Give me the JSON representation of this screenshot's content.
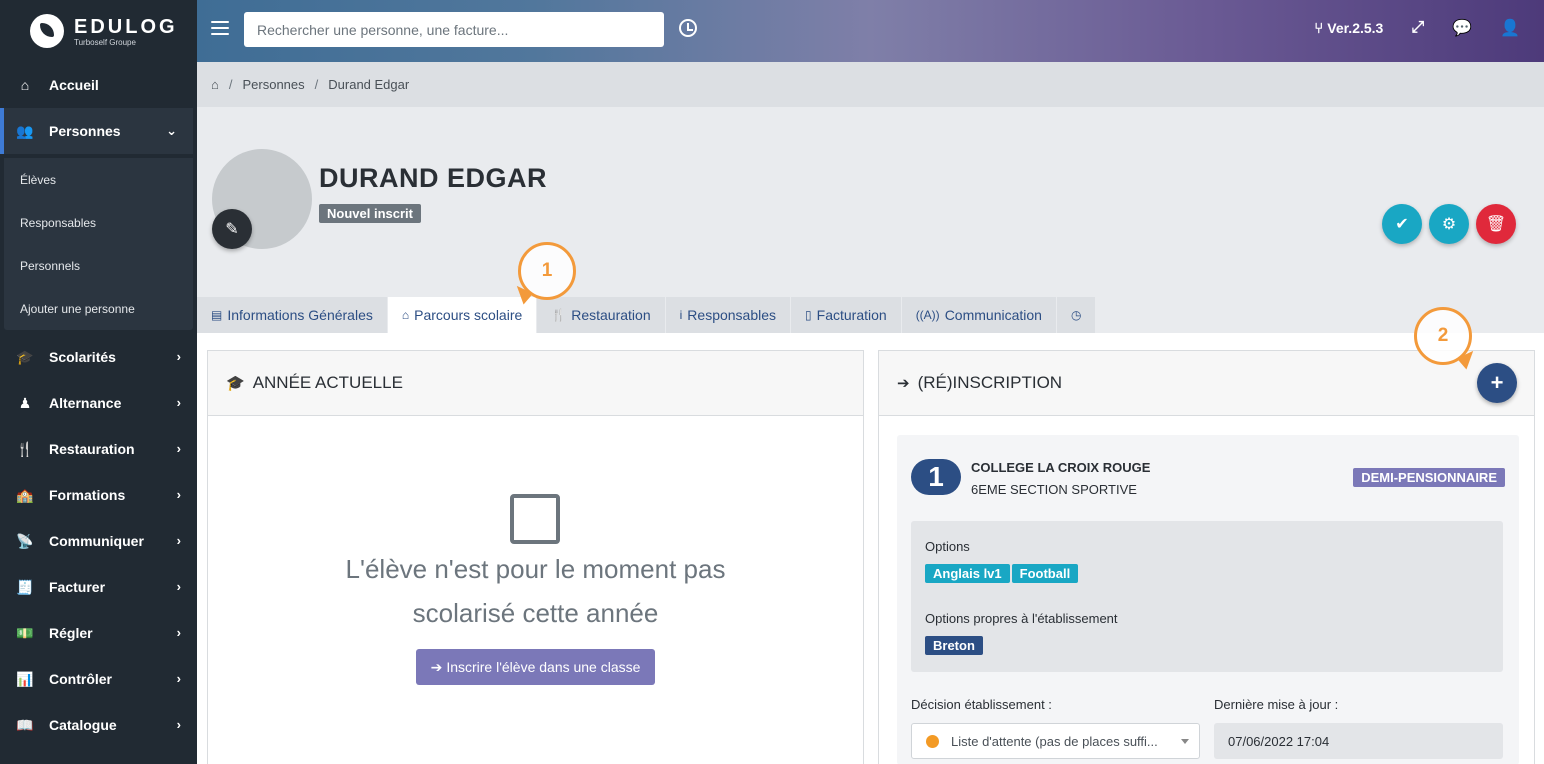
{
  "app": {
    "logo_title": "EDULOG",
    "logo_subtitle": "Turboself Groupe"
  },
  "sidebar": {
    "items": [
      {
        "label": "Accueil",
        "icon": "home-icon"
      },
      {
        "label": "Personnes",
        "icon": "users-icon",
        "active": true
      },
      {
        "label": "Scolarités",
        "icon": "graduation-cap-icon"
      },
      {
        "label": "Alternance",
        "icon": "user-tie-icon"
      },
      {
        "label": "Restauration",
        "icon": "utensils-icon"
      },
      {
        "label": "Formations",
        "icon": "school-icon"
      },
      {
        "label": "Communiquer",
        "icon": "broadcast-icon"
      },
      {
        "label": "Facturer",
        "icon": "invoice-icon"
      },
      {
        "label": "Régler",
        "icon": "money-icon"
      },
      {
        "label": "Contrôler",
        "icon": "chart-icon"
      },
      {
        "label": "Catalogue",
        "icon": "book-icon"
      }
    ],
    "submenu": [
      "Élèves",
      "Responsables",
      "Personnels",
      "Ajouter une personne"
    ]
  },
  "topbar": {
    "search_placeholder": "Rechercher une personne, une facture...",
    "version": "Ver.2.5.3"
  },
  "breadcrumb": {
    "items": [
      "Personnes",
      "Durand Edgar"
    ]
  },
  "profile": {
    "name": "DURAND EDGAR",
    "status": "Nouvel inscrit"
  },
  "tabs": [
    {
      "label": "Informations Générales",
      "icon": "id-card-icon"
    },
    {
      "label": "Parcours scolaire",
      "icon": "school-icon",
      "active": true
    },
    {
      "label": "Restauration",
      "icon": "utensils-icon"
    },
    {
      "label": "Responsables",
      "icon": "person-icon"
    },
    {
      "label": "Facturation",
      "icon": "invoice-icon"
    },
    {
      "label": "Communication",
      "icon": "broadcast-icon"
    },
    {
      "label": "",
      "icon": "clock-icon"
    }
  ],
  "callouts": [
    "1",
    "2"
  ],
  "current_year": {
    "title": "ANNÉE ACTUELLE",
    "empty_line1": "L'élève n'est pour le moment pas",
    "empty_line2": "scolarisé cette année",
    "enroll_button": "Inscrire l'élève dans une classe"
  },
  "inscription": {
    "title": "(RÉ)INSCRIPTION",
    "number": "1",
    "school": "COLLEGE LA CROIX ROUGE",
    "class": "6EME SECTION SPORTIVE",
    "regime": "DEMI-PENSIONNAIRE",
    "options_label": "Options",
    "options": [
      "Anglais lv1",
      "Football"
    ],
    "own_options_label": "Options propres à l'établissement",
    "own_options": [
      "Breton"
    ],
    "decision_label": "Décision établissement :",
    "decision_value": "Liste d'attente (pas de places suffi...",
    "updated_label": "Dernière mise à jour :",
    "updated_value": "07/06/2022 17:04"
  },
  "colors": {
    "sidebar_bg": "#212a33",
    "primary": "#2c4e84",
    "accent_purple": "#7b78b8",
    "teal": "#19a7c4",
    "danger": "#e0293b",
    "callout": "#f39a3b",
    "waiting_dot": "#f39a25"
  }
}
